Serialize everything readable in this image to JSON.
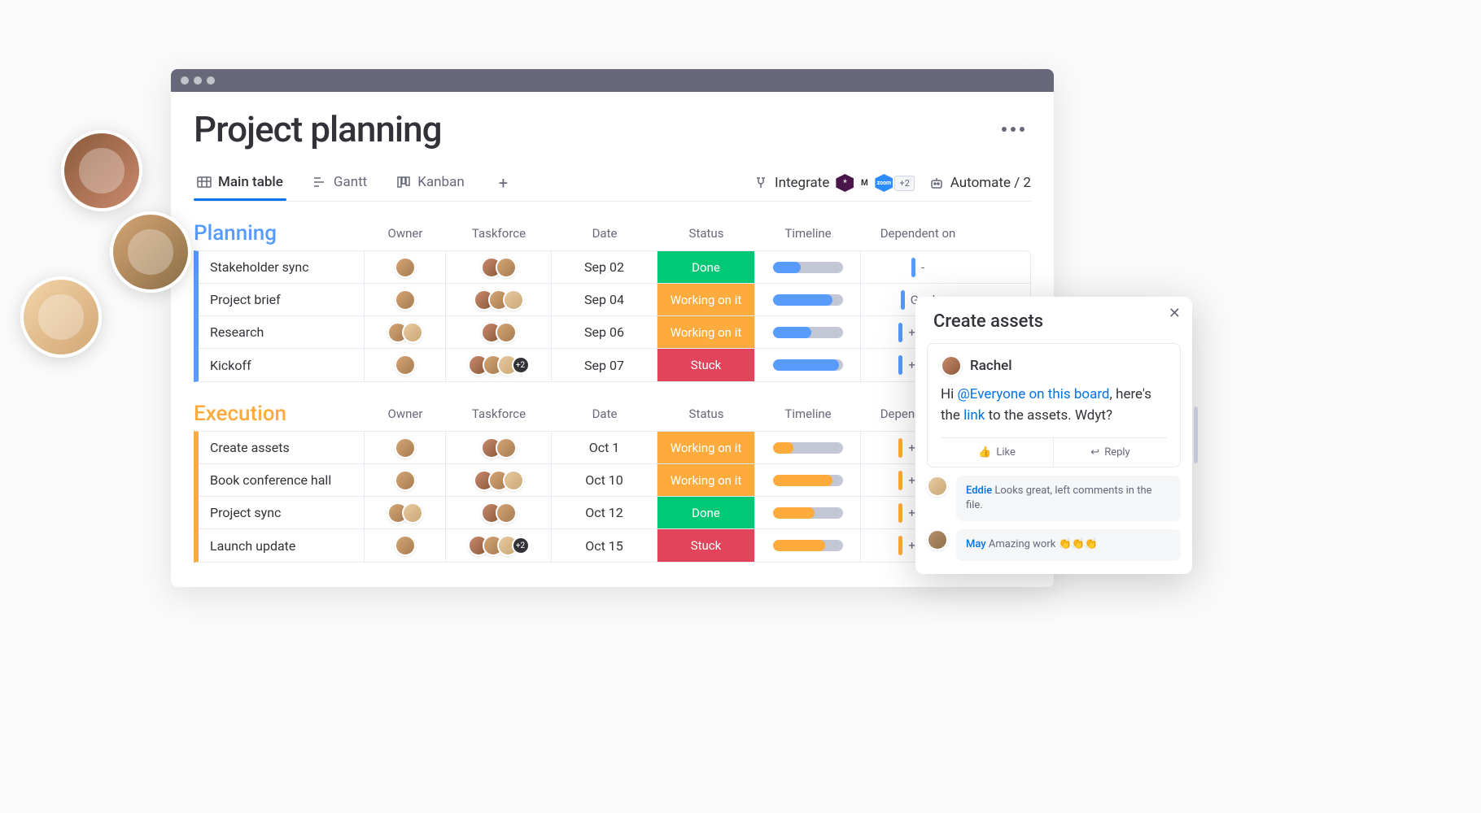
{
  "board": {
    "title": "Project planning",
    "views": {
      "main": "Main table",
      "gantt": "Gantt",
      "kanban": "Kanban"
    },
    "integrate_label": "Integrate",
    "integrate_plus": "+2",
    "automate_label": "Automate / 2"
  },
  "columns": [
    "Owner",
    "Taskforce",
    "Date",
    "Status",
    "Timeline",
    "Dependent on"
  ],
  "groups": [
    {
      "name": "Planning",
      "color": "blue",
      "rows": [
        {
          "name": "Stakeholder sync",
          "date": "Sep 02",
          "status": "Done",
          "status_class": "st-done",
          "tl_color": "tf-blue",
          "tl_width": 40,
          "dep": "-",
          "owner_count": 1,
          "tf_count": 2,
          "tf_more": 0
        },
        {
          "name": "Project brief",
          "date": "Sep 04",
          "status": "Working on it",
          "status_class": "st-working",
          "tl_color": "tf-blue",
          "tl_width": 85,
          "dep": "Goal",
          "owner_count": 1,
          "tf_count": 3,
          "tf_more": 0
        },
        {
          "name": "Research",
          "date": "Sep 06",
          "status": "Working on it",
          "status_class": "st-working",
          "tl_color": "tf-blue",
          "tl_width": 55,
          "dep": "+Add",
          "owner_count": 2,
          "tf_count": 2,
          "tf_more": 0
        },
        {
          "name": "Kickoff",
          "date": "Sep 07",
          "status": "Stuck",
          "status_class": "st-stuck",
          "tl_color": "tf-blue",
          "tl_width": 95,
          "dep": "+Add",
          "owner_count": 1,
          "tf_count": 3,
          "tf_more": 2
        }
      ]
    },
    {
      "name": "Execution",
      "color": "orange",
      "rows": [
        {
          "name": "Create assets",
          "date": "Oct 1",
          "status": "Working on it",
          "status_class": "st-working",
          "tl_color": "tf-orange",
          "tl_width": 30,
          "dep": "+Add",
          "owner_count": 1,
          "tf_count": 2,
          "tf_more": 0
        },
        {
          "name": "Book conference hall",
          "date": "Oct 10",
          "status": "Working on it",
          "status_class": "st-working",
          "tl_color": "tf-orange",
          "tl_width": 85,
          "dep": "+Add",
          "owner_count": 1,
          "tf_count": 3,
          "tf_more": 0
        },
        {
          "name": "Project sync",
          "date": "Oct 12",
          "status": "Done",
          "status_class": "st-done",
          "tl_color": "tf-orange",
          "tl_width": 60,
          "dep": "+Add",
          "owner_count": 2,
          "tf_count": 2,
          "tf_more": 0
        },
        {
          "name": "Launch update",
          "date": "Oct 15",
          "status": "Stuck",
          "status_class": "st-stuck",
          "tl_color": "tf-orange",
          "tl_width": 75,
          "dep": "+Add",
          "owner_count": 1,
          "tf_count": 3,
          "tf_more": 2
        }
      ]
    }
  ],
  "panel": {
    "title": "Create assets",
    "author": "Rachel",
    "body_pre": "Hi ",
    "mention": "@Everyone on this board",
    "body_mid": ", here's the ",
    "link_text": "link",
    "body_post": " to the assets. Wdyt?",
    "like": "Like",
    "reply": "Reply",
    "replies": [
      {
        "author": "Eddie",
        "text": " Looks great, left comments in the file."
      },
      {
        "author": "May",
        "text": " Amazing work 👏👏👏"
      }
    ]
  }
}
